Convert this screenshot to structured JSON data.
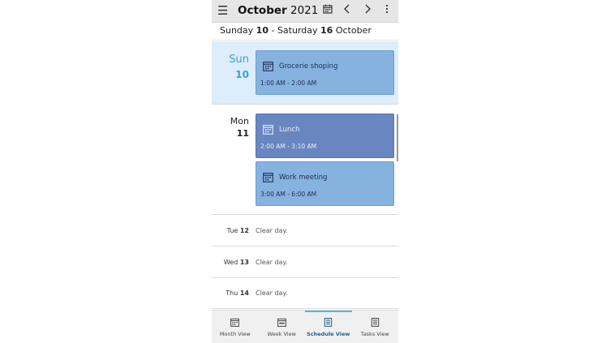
{
  "header": {
    "menu_icon": "hamburger-icon",
    "month": "October",
    "year": "2021",
    "calendar_icon": "calendar-icon",
    "prev_icon": "chevron-left-icon",
    "next_icon": "chevron-right-icon",
    "more_icon": "more-vertical-icon"
  },
  "range": {
    "start_day": "Sunday",
    "start_num": "10",
    "sep": " - ",
    "end_day": "Saturday",
    "end_num": "16",
    "month": "October"
  },
  "days": [
    {
      "name": "Sun",
      "num": "10",
      "events": [
        {
          "title": "Grocerie shoping",
          "time": "1:00 AM - 2:00 AM",
          "color": "#86b2e0"
        }
      ]
    },
    {
      "name": "Mon",
      "num": "11",
      "events": [
        {
          "title": "Lunch",
          "time": "2:00 AM - 3:10 AM",
          "color": "#6a86c0"
        },
        {
          "title": "Work meeting",
          "time": "3:00 AM - 6:00 AM",
          "color": "#86b2e0"
        }
      ]
    },
    {
      "name": "Tue",
      "num": "12",
      "note": "Clear day."
    },
    {
      "name": "Wed",
      "num": "13",
      "note": "Clear day."
    },
    {
      "name": "Thu",
      "num": "14",
      "note": "Clear day."
    }
  ],
  "tabs": [
    {
      "label": "Month View",
      "icon": "calendar-month-icon"
    },
    {
      "label": "Week View",
      "icon": "calendar-week-icon"
    },
    {
      "label": "Schedule View",
      "icon": "schedule-list-icon",
      "active": true
    },
    {
      "label": "Tasks View",
      "icon": "tasks-list-icon"
    }
  ],
  "colors": {
    "accent": "#3aa0d8",
    "today_bg": "#ddeefa",
    "event_light": "#86b2e0",
    "event_dark": "#6a86c0"
  }
}
